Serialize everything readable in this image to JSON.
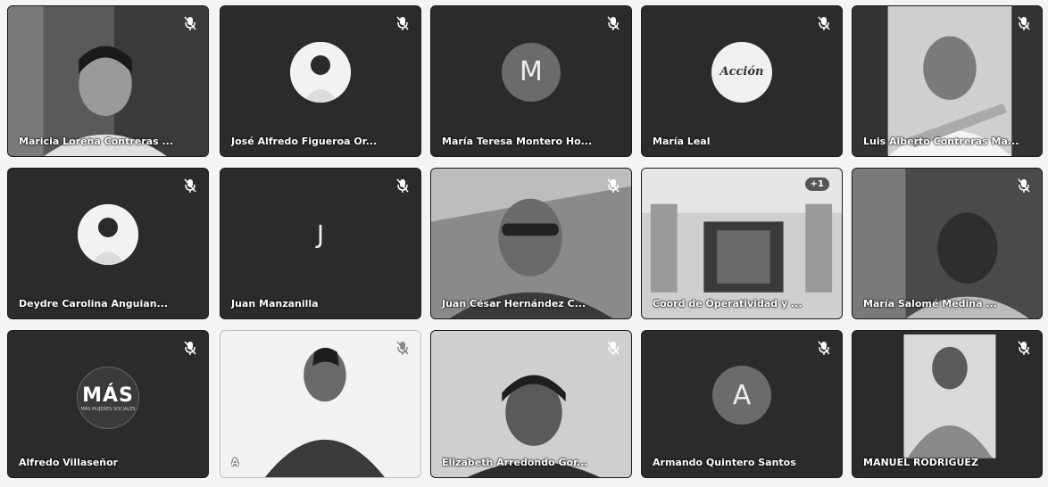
{
  "participants": [
    {
      "name": "Maricia Lorena Contreras ..."
    },
    {
      "name": "José Alfredo Figueroa Or..."
    },
    {
      "name": "María Teresa Montero Ho...",
      "initial": "M"
    },
    {
      "name": "María Leal",
      "logo_text": "Acción"
    },
    {
      "name": "Luis Alberto Contreras Ma..."
    },
    {
      "name": "Deydre Carolina Anguian..."
    },
    {
      "name": "Juan Manzanilla",
      "initial": "J"
    },
    {
      "name": "Juan César Hernández C..."
    },
    {
      "name": "Coord de Operatividad y ...",
      "badge": "+1"
    },
    {
      "name": "María Salomé Medina ..."
    },
    {
      "name": "Alfredo Villaseñor",
      "logo_text": "MÁS",
      "logo_subtext": "MÁS MUJERES SOCIALES"
    },
    {
      "name": "A"
    },
    {
      "name": "Elizabeth Arredondo Gor..."
    },
    {
      "name": "Armando Quintero Santos",
      "initial": "A"
    },
    {
      "name": "MANUEL RODRIGUEZ"
    }
  ],
  "icons": {
    "muted": "mic-off-icon"
  },
  "colors": {
    "tile_bg": "#2b2b2b",
    "page_bg": "#f4f4f4",
    "avatar_bg": "#6b6b6b"
  }
}
